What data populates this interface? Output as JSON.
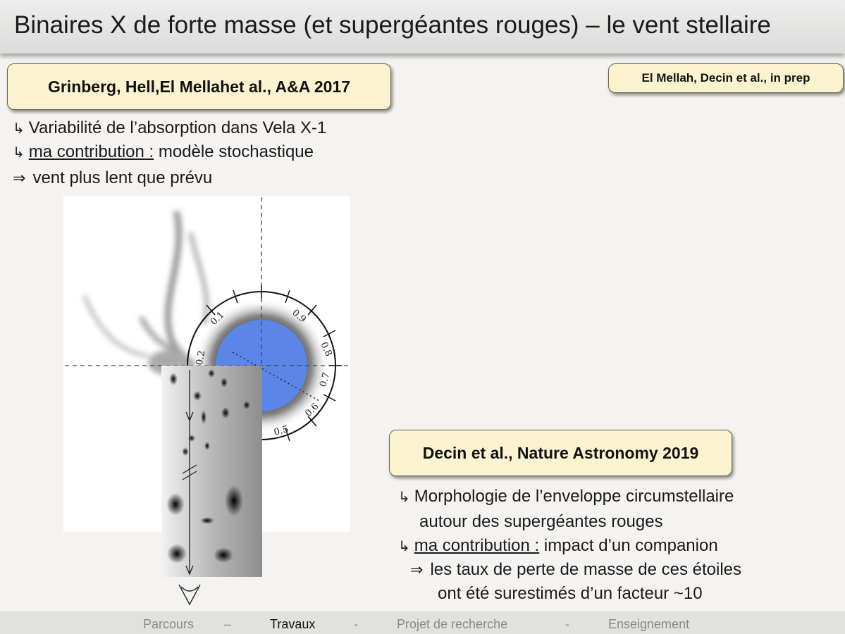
{
  "title": "Binaires X de forte masse (et supergéantes rouges) – le vent stellaire",
  "ref1": {
    "authors_a": "Grinberg, Hell, ",
    "authors_bold": "El Mellah",
    "authors_b": " et al., A&A 2017"
  },
  "ref2": {
    "authors_bold": "El Mellah",
    "authors_b": ", Decin et al., in prep"
  },
  "ref3": {
    "text": "Decin et al., Nature Astronomy 2019"
  },
  "left_bullets": {
    "b1": "Variabilité de l’absorption dans Vela X-1",
    "b2_u": "ma contribution :",
    "b2_rest": " modèle stochastique",
    "b3": "vent plus lent que prévu"
  },
  "right_bullets": {
    "b1_l1": "Morphologie de l’enveloppe circumstellaire",
    "b1_l2": "autour des supergéantes rouges",
    "b2_u": "ma contribution :",
    "b2_rest": " impact d’un companion",
    "b3_l1": "les taux de perte de masse de ces étoiles",
    "b3_l2": "ont été surestimés d’un facteur ~10"
  },
  "symbols": {
    "hook": "↳",
    "implies": "⇒"
  },
  "figure": {
    "phase_labels": [
      "0.1",
      "0.2",
      "0.5",
      "0.6",
      "0.7",
      "0.8",
      "0.9"
    ],
    "star_color": "#5b86e8"
  },
  "nav": {
    "items": [
      "Parcours",
      "Travaux",
      "Projet de recherche",
      "Enseignement"
    ],
    "separators": [
      "–",
      "-",
      "-"
    ],
    "active": "Travaux"
  }
}
